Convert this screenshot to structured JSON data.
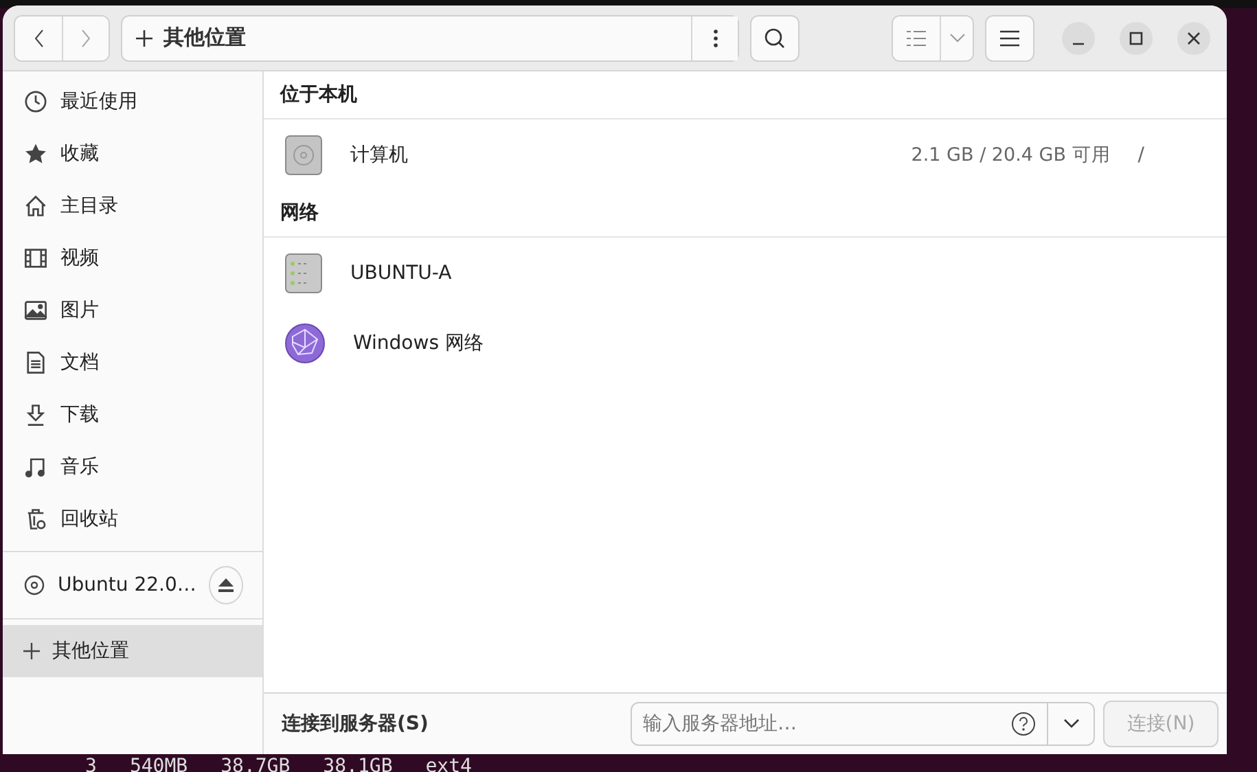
{
  "header": {
    "location": "其他位置"
  },
  "sidebar": {
    "places": [
      {
        "label": "最近使用",
        "kind": "recent",
        "selected": false
      },
      {
        "label": "收藏",
        "kind": "star",
        "selected": false
      },
      {
        "label": "主目录",
        "kind": "home",
        "selected": false
      },
      {
        "label": "视频",
        "kind": "video",
        "selected": false
      },
      {
        "label": "图片",
        "kind": "picture",
        "selected": false
      },
      {
        "label": "文档",
        "kind": "document",
        "selected": false
      },
      {
        "label": "下载",
        "kind": "download",
        "selected": false
      },
      {
        "label": "音乐",
        "kind": "music",
        "selected": false
      },
      {
        "label": "回收站",
        "kind": "trash",
        "selected": false
      }
    ],
    "devices": [
      {
        "label": "Ubuntu 22.0…",
        "selected": false
      }
    ],
    "other": {
      "label": "其他位置",
      "selected": true
    }
  },
  "sections": [
    {
      "title": "位于本机",
      "items": [
        {
          "name": "计算机",
          "kind": "disk",
          "usage": "2.1 GB / 20.4 GB 可用",
          "path": "/"
        }
      ]
    },
    {
      "title": "网络",
      "items": [
        {
          "name": "UBUNTU-A",
          "kind": "server"
        },
        {
          "name": "Windows 网络",
          "kind": "globe"
        }
      ]
    }
  ],
  "connect": {
    "label": "连接到服务器(S)",
    "placeholder": "输入服务器地址…",
    "button": "连接(N)",
    "disabled": true
  },
  "terminal": [
    "3",
    "540MB",
    "38.7GB",
    "38.1GB",
    "ext4"
  ]
}
